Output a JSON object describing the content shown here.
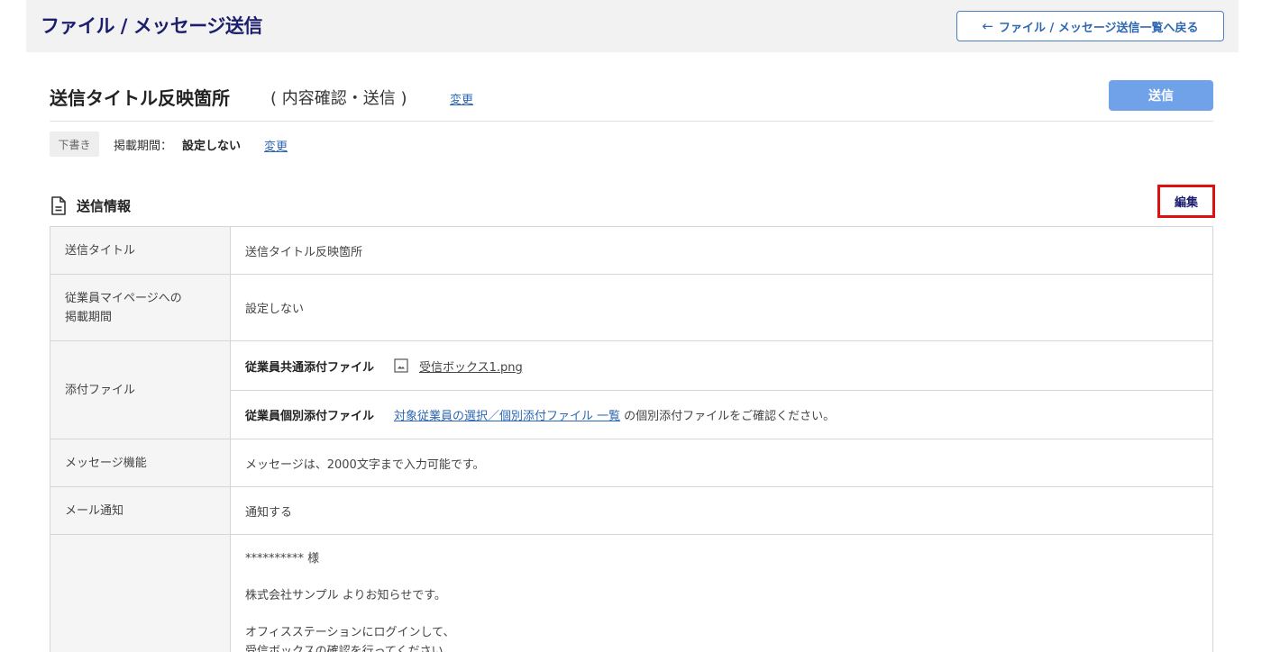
{
  "header": {
    "title": "ファイル / メッセージ送信",
    "back_label": "ファイル / メッセージ送信一覧へ戻る"
  },
  "send": {
    "title": "送信タイトル反映箇所",
    "title_suffix": "( 内容確認・送信 )",
    "title_change": "変更",
    "send_label": "送信"
  },
  "status": {
    "badge": "下書き",
    "period_label": "掲載期間：",
    "period_value": "設定しない",
    "period_change": "変更"
  },
  "section": {
    "title": "送信情報",
    "edit_label": "編集",
    "icon": "document-icon"
  },
  "table": {
    "rows": [
      {
        "label": "送信タイトル",
        "value": "送信タイトル反映箇所"
      },
      {
        "label": "従業員マイページへの掲載期間",
        "label_line1": "従業員マイページへの",
        "label_line2": "掲載期間",
        "value": "設定しない"
      },
      {
        "label": "添付ファイル"
      },
      {
        "label": "メッセージ機能",
        "value": "メッセージは、2000文字まで入力可能です。"
      },
      {
        "label": "メール通知",
        "value": "通知する"
      }
    ],
    "attachments": {
      "common_label": "従業員共通添付ファイル",
      "common_file": "受信ボックス1.png",
      "individual_label": "従業員個別添付ファイル",
      "individual_link": "対象従業員の選択／個別添付ファイル 一覧",
      "individual_text": "の個別添付ファイルをご確認ください。"
    },
    "mail_body": {
      "line1": "********** 様",
      "line2": "株式会社サンプル よりお知らせです。",
      "line3": "オフィスステーションにログインして、",
      "line4": "受信ボックスの確認を行ってください。"
    }
  },
  "colors": {
    "title_navy": "#1b1e6d",
    "link_blue": "#2e67b1",
    "send_button": "#6fa2e8",
    "edit_highlight": "#e01010"
  }
}
